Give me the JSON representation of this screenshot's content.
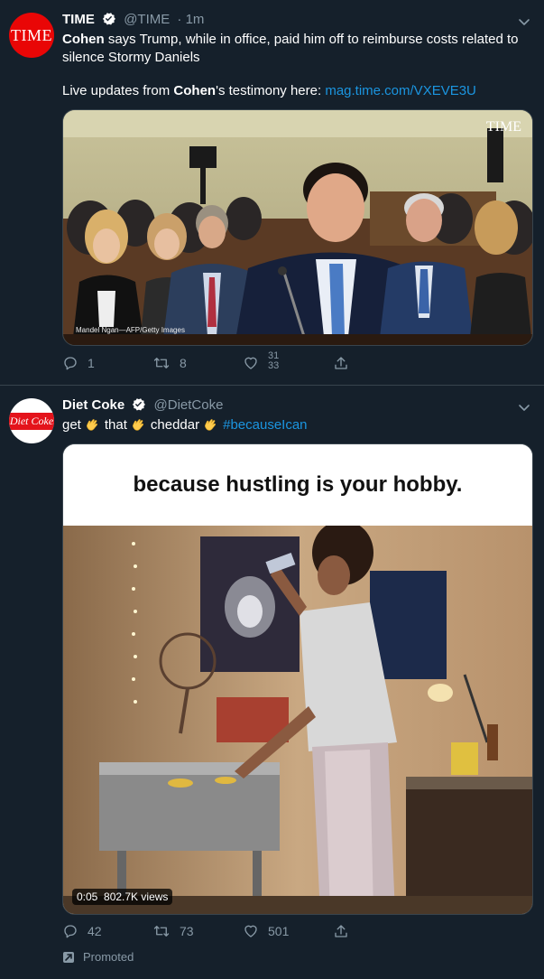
{
  "tweets": [
    {
      "name": "TIME",
      "handle": "@TIME",
      "time": "· 1m",
      "avatar_text": "TIME",
      "text": {
        "bold_1": "Cohen",
        "part_1": " says Trump, while in office, paid him off to reimburse costs related to silence Stormy Daniels",
        "part_2": "Live updates from ",
        "bold_2": "Cohen",
        "part_3": "'s testimony here: ",
        "link": "mag.time.com/VXEVE3U"
      },
      "media": {
        "watermark": "TIME",
        "credit": "Mandel Ngan—AFP/Getty Images"
      },
      "actions": {
        "replies": "1",
        "retweets": "8",
        "likes": "31\n33"
      }
    },
    {
      "name": "Diet Coke",
      "handle": "@DietCoke",
      "avatar_text": "Diet Coke",
      "text": {
        "w1": "get",
        "w2": "that",
        "w3": "cheddar",
        "hashtag": "#becauseIcan"
      },
      "media": {
        "banner": "because hustling is your hobby.",
        "time": "0:05",
        "views": "802.7K views"
      },
      "actions": {
        "replies": "42",
        "retweets": "73",
        "likes": "501"
      },
      "promoted": "Promoted"
    }
  ],
  "colors": {
    "background": "#15202b",
    "divider": "#38444d",
    "secondary_text": "#8899a6",
    "link": "#1b95e0",
    "verified": "#1da1f2",
    "time_red": "#e90606",
    "coke_red": "#e4131b"
  },
  "icons": [
    "verified-badge-icon",
    "chevron-down-icon",
    "reply-icon",
    "retweet-icon",
    "like-icon",
    "share-icon",
    "promoted-icon",
    "clap-emoji-icon"
  ]
}
